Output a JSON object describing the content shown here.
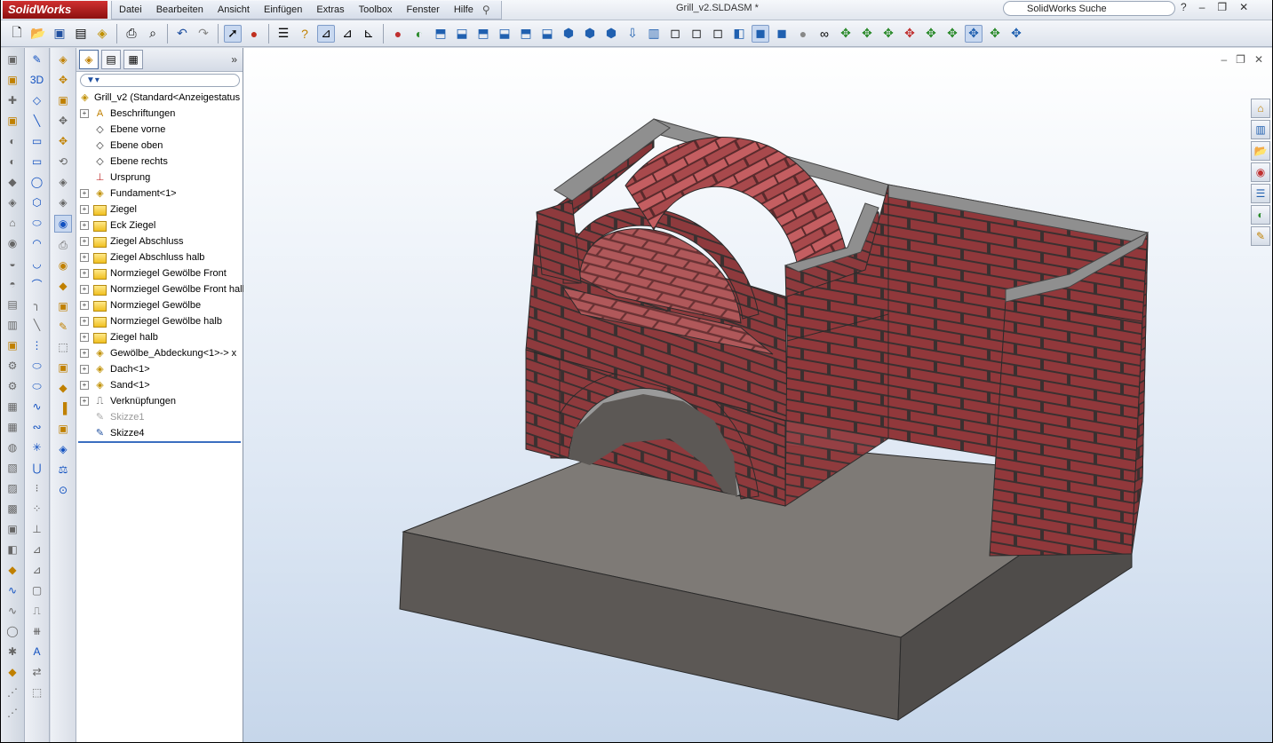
{
  "app": {
    "brand": "SolidWorks",
    "doc_title": "Grill_v2.SLDASM *",
    "search_placeholder": "SolidWorks Suche"
  },
  "menu": [
    "Datei",
    "Bearbeiten",
    "Ansicht",
    "Einfügen",
    "Extras",
    "Toolbox",
    "Fenster",
    "Hilfe"
  ],
  "tree": {
    "root": "Grill_v2  (Standard<Anzeigestatus",
    "items": [
      {
        "label": "Beschriftungen",
        "icon": "annotations-icon",
        "expand": true
      },
      {
        "label": "Ebene vorne",
        "icon": "plane-icon",
        "expand": false
      },
      {
        "label": "Ebene oben",
        "icon": "plane-icon",
        "expand": false
      },
      {
        "label": "Ebene rechts",
        "icon": "plane-icon",
        "expand": false
      },
      {
        "label": "Ursprung",
        "icon": "origin-icon",
        "expand": false
      },
      {
        "label": "Fundament<1>",
        "icon": "part-icon",
        "expand": true
      },
      {
        "label": "Ziegel",
        "icon": "folder-icon",
        "expand": true
      },
      {
        "label": "Eck Ziegel",
        "icon": "folder-icon",
        "expand": true
      },
      {
        "label": "Ziegel Abschluss",
        "icon": "folder-icon",
        "expand": true
      },
      {
        "label": "Ziegel Abschluss halb",
        "icon": "folder-icon",
        "expand": true
      },
      {
        "label": "Normziegel Gewölbe Front",
        "icon": "folder-icon",
        "expand": true
      },
      {
        "label": "Normziegel Gewölbe Front halb",
        "icon": "folder-icon",
        "expand": true
      },
      {
        "label": "Normziegel Gewölbe",
        "icon": "folder-icon",
        "expand": true
      },
      {
        "label": "Normziegel Gewölbe halb",
        "icon": "folder-icon",
        "expand": true
      },
      {
        "label": "Ziegel halb",
        "icon": "folder-icon",
        "expand": true
      },
      {
        "label": "Gewölbe_Abdeckung<1>-> x",
        "icon": "part-icon",
        "expand": true
      },
      {
        "label": "Dach<1>",
        "icon": "part-icon",
        "expand": true
      },
      {
        "label": "Sand<1>",
        "icon": "part-icon",
        "expand": true
      },
      {
        "label": "Verknüpfungen",
        "icon": "mates-icon",
        "expand": true
      },
      {
        "label": "Skizze1",
        "icon": "sketch-icon",
        "expand": false,
        "dim": true
      },
      {
        "label": "Skizze4",
        "icon": "sketch-icon",
        "expand": false
      }
    ]
  },
  "colors": {
    "brick": "#8e3a3d",
    "brick_mortar": "#3a3030",
    "cap_stone": "#8f8f8f",
    "slab_top": "#7e7a76",
    "slab_side": "#5c5855",
    "arch_inner": "#a8a8a8"
  }
}
